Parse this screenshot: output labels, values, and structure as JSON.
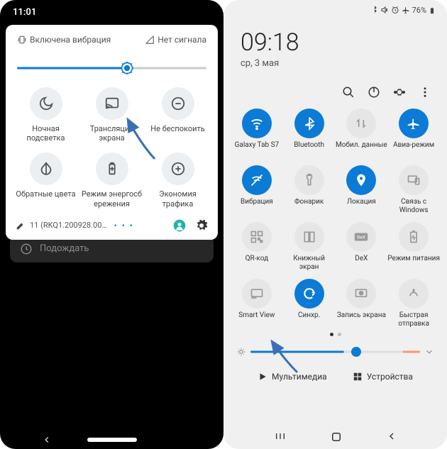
{
  "left": {
    "time": "11:01",
    "vibration_status": "Включена вибрация",
    "signal_status": "Нет сигнала",
    "brightness_percent": 58,
    "tiles": [
      {
        "name": "night-light",
        "label": "Ночная подсветка"
      },
      {
        "name": "cast",
        "label": "Трансляция экрана"
      },
      {
        "name": "dnd",
        "label": "Не беспокоить"
      },
      {
        "name": "invert-colors",
        "label": "Обратные цвета"
      },
      {
        "name": "battery-saver",
        "label": "Режим энергосб ережения"
      },
      {
        "name": "data-saver",
        "label": "Экономия трафика"
      }
    ],
    "build": "11 (RKQ1.200928.00…",
    "notification": "Подождать"
  },
  "right": {
    "status_icons": "✱ ✕ ⏰ ✈ 76%",
    "time": "09:18",
    "date": "ср, 3 мая",
    "tiles": [
      {
        "name": "wifi",
        "label": "Galaxy Tab S7",
        "on": true
      },
      {
        "name": "bluetooth",
        "label": "Bluetooth",
        "on": true
      },
      {
        "name": "mobile-data",
        "label": "Мобил. данные",
        "on": false
      },
      {
        "name": "airplane",
        "label": "Авиа-режим",
        "on": true
      },
      {
        "name": "vibration",
        "label": "Вибрация",
        "on": true
      },
      {
        "name": "flashlight",
        "label": "Фонарик",
        "on": false
      },
      {
        "name": "location",
        "label": "Локация",
        "on": true
      },
      {
        "name": "windows-link",
        "label": "Связь с Windows",
        "on": false
      },
      {
        "name": "qr",
        "label": "QR-код",
        "on": false
      },
      {
        "name": "book",
        "label": "Книжный экран",
        "on": false
      },
      {
        "name": "dex",
        "label": "DeX",
        "on": false
      },
      {
        "name": "power-mode",
        "label": "Режим питания",
        "on": false
      },
      {
        "name": "smart-view",
        "label": "Smart View",
        "on": false
      },
      {
        "name": "sync",
        "label": "Синхр.",
        "on": true
      },
      {
        "name": "screen-record",
        "label": "Запись экрана",
        "on": false
      },
      {
        "name": "quick-share",
        "label": "Быстрая отправка",
        "on": false
      }
    ],
    "brightness_percent": 55,
    "footer": {
      "media": "Мультимедиа",
      "devices": "Устройства"
    }
  }
}
